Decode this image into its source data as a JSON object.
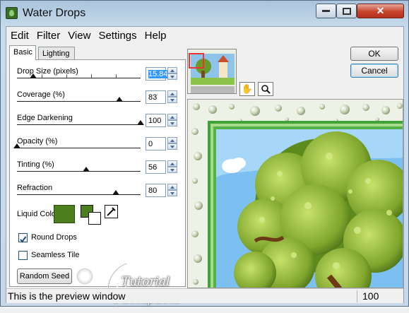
{
  "window": {
    "title": "Water Drops"
  },
  "menu": [
    "Edit",
    "Filter",
    "View",
    "Settings",
    "Help"
  ],
  "tabs": {
    "basic": "Basic",
    "lighting": "Lighting"
  },
  "params": {
    "drop_size": {
      "label": "Drop Size (pixels)",
      "value": "15.84",
      "level": 0.13
    },
    "coverage": {
      "label": "Coverage (%)",
      "value": "83",
      "level": 0.83
    },
    "edge_darkening": {
      "label": "Edge Darkening",
      "value": "100",
      "level": 1.0
    },
    "opacity": {
      "label": "Opacity (%)",
      "value": "0",
      "level": 0.0
    },
    "tinting": {
      "label": "Tinting (%)",
      "value": "56",
      "level": 0.56
    },
    "refraction": {
      "label": "Refraction",
      "value": "80",
      "level": 0.8
    }
  },
  "liquid_color": {
    "label": "Liquid Color",
    "color": "#4e7f1f"
  },
  "checkboxes": {
    "round_drops": {
      "label": "Round Drops",
      "checked": true
    },
    "seamless_tile": {
      "label": "Seamless Tile",
      "checked": false
    }
  },
  "random_seed": "Random Seed",
  "buttons": {
    "ok": "OK",
    "cancel": "Cancel"
  },
  "tools": {
    "hand": "hand-icon",
    "zoom": "magnifier-icon"
  },
  "watermark": {
    "line1": "Tutorial",
    "line2": "Paolapaola"
  },
  "status": {
    "text": "This is the preview window",
    "zoom": "100"
  }
}
